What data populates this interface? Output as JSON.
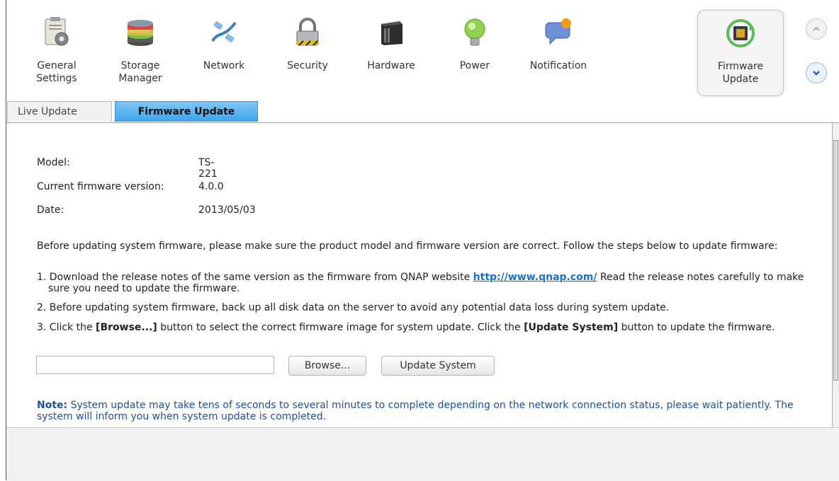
{
  "toolbar": {
    "items": [
      {
        "label": "General\nSettings",
        "icon": "general-settings-icon"
      },
      {
        "label": "Storage\nManager",
        "icon": "storage-manager-icon"
      },
      {
        "label": "Network",
        "icon": "network-icon"
      },
      {
        "label": "Security",
        "icon": "security-icon"
      },
      {
        "label": "Hardware",
        "icon": "hardware-icon"
      },
      {
        "label": "Power",
        "icon": "power-icon"
      },
      {
        "label": "Notification",
        "icon": "notification-icon"
      },
      {
        "label": "Firmware\nUpdate",
        "icon": "firmware-update-icon",
        "active": true
      }
    ]
  },
  "tabs": {
    "live_update": "Live Update",
    "firmware_update": "Firmware Update"
  },
  "info": {
    "model_label": "Model:",
    "model_value": "TS-221",
    "version_label": "Current firmware version:",
    "version_value": "4.0.0",
    "date_label": "Date:",
    "date_value": "2013/05/03"
  },
  "instructions": {
    "intro": "Before updating system firmware, please make sure the product model and firmware version are correct. Follow the steps below to update firmware:",
    "step1_a": "1. Download the release notes of the same version as the firmware from QNAP website ",
    "step1_link": "http://www.qnap.com/",
    "step1_b": " Read the release notes carefully to make sure you need to update the firmware.",
    "step2": "2. Before updating system firmware, back up all disk data on the server to avoid any potential data loss during system update.",
    "step3_a": "3. Click the ",
    "step3_browse": "[Browse...]",
    "step3_b": " button to select the correct firmware image for system update. Click the ",
    "step3_update": "[Update System]",
    "step3_c": " button to update the firmware."
  },
  "form": {
    "file_value": "",
    "browse_label": "Browse...",
    "update_label": "Update System"
  },
  "note": {
    "label": "Note:",
    "text": " System update may take tens of seconds to several minutes to complete depending on the network connection status, please wait patiently. The system will inform you when system update is completed."
  },
  "colors": {
    "active_tab": "#3ea3e8",
    "link": "#1a6fc8",
    "note": "#1f4f9a"
  }
}
